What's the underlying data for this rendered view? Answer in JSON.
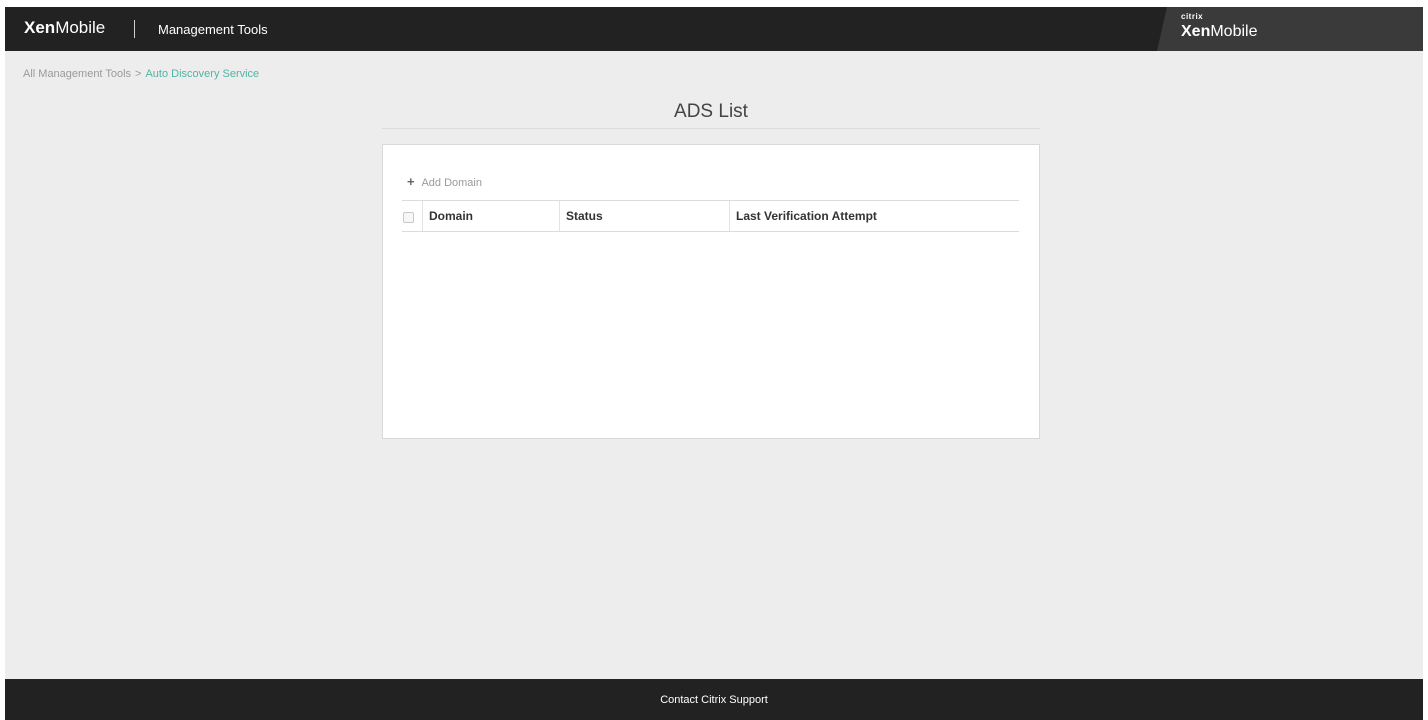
{
  "header": {
    "brand_bold": "Xen",
    "brand_light": "Mobile",
    "section_title": "Management Tools",
    "right_logo_top": "citrix",
    "right_logo_bold": "Xen",
    "right_logo_light": "Mobile"
  },
  "breadcrumb": {
    "parent": "All Management Tools",
    "separator": ">",
    "current": "Auto Discovery Service"
  },
  "page": {
    "title": "ADS List"
  },
  "toolbar": {
    "add_domain_icon": "plus-icon",
    "add_domain_label": "Add Domain"
  },
  "table": {
    "columns": [
      "Domain",
      "Status",
      "Last Verification Attempt"
    ],
    "rows": []
  },
  "footer": {
    "link": "Contact Citrix Support"
  },
  "colors": {
    "header_bg": "#222222",
    "page_bg": "#ededed",
    "accent": "#4fb5a3"
  }
}
